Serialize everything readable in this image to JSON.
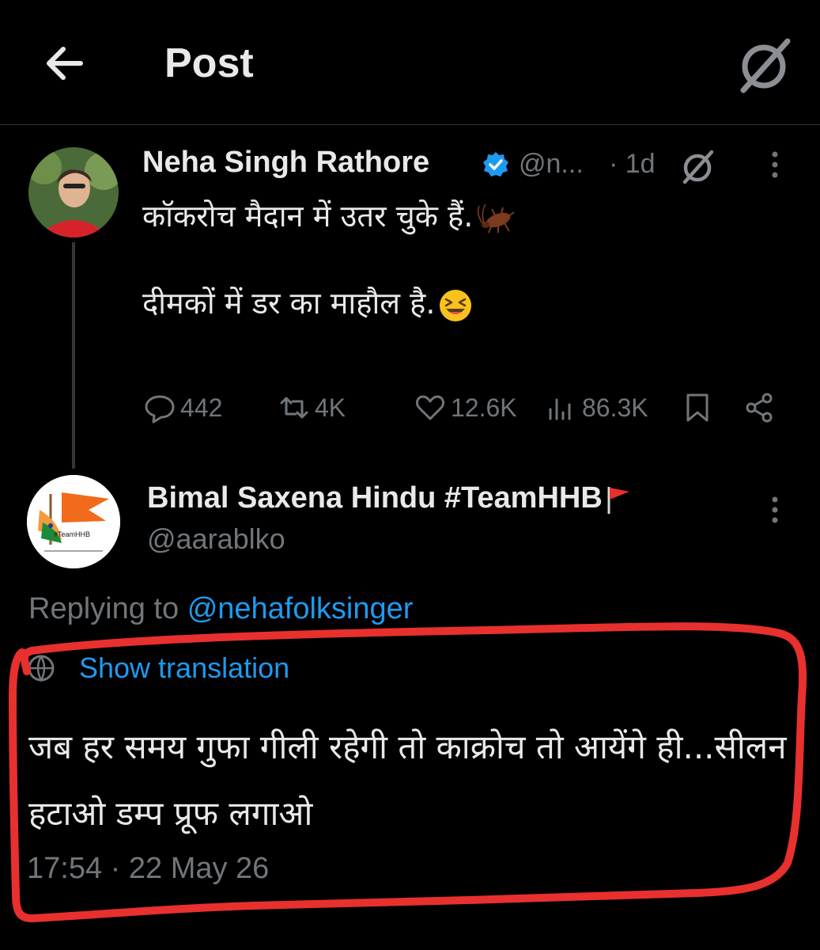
{
  "header": {
    "title": "Post",
    "back_icon": "arrow-left-icon",
    "grok_icon": "grok-icon"
  },
  "post": {
    "author_name": "Neha Singh Rathore",
    "verified": true,
    "handle": "@n...",
    "time": "· 1d",
    "text_line1": "कॉकरोच मैदान में उतर चुके हैं.",
    "text_line1_emoji": "cockroach",
    "text_line2": "दीमकों में डर का माहौल है.",
    "text_line2_emoji": "grinning-squinting-face",
    "stats": {
      "replies": "442",
      "reposts": "4K",
      "likes": "12.6K",
      "views": "86.3K"
    }
  },
  "reply": {
    "author_name": "Bimal Saxena Hindu #TeamHHB",
    "author_emoji": "triangular-flag",
    "handle": "@aarablko",
    "avatar_label": "#TeamHHB",
    "replying_prefix": "Replying to",
    "replying_to": "@nehafolksinger",
    "show_translation": "Show translation",
    "text": "जब हर समय गुफा गीली रहेगी तो काक्रोच तो आयेंगे ही...सीलन हटाओ डम्प प्रूफ लगाओ",
    "timestamp": "17:54 · 22 May 26"
  },
  "colors": {
    "background": "#000000",
    "text": "#e7e9ea",
    "muted": "#71767b",
    "link": "#1d9bf0",
    "annotation_red": "#e8302e"
  }
}
